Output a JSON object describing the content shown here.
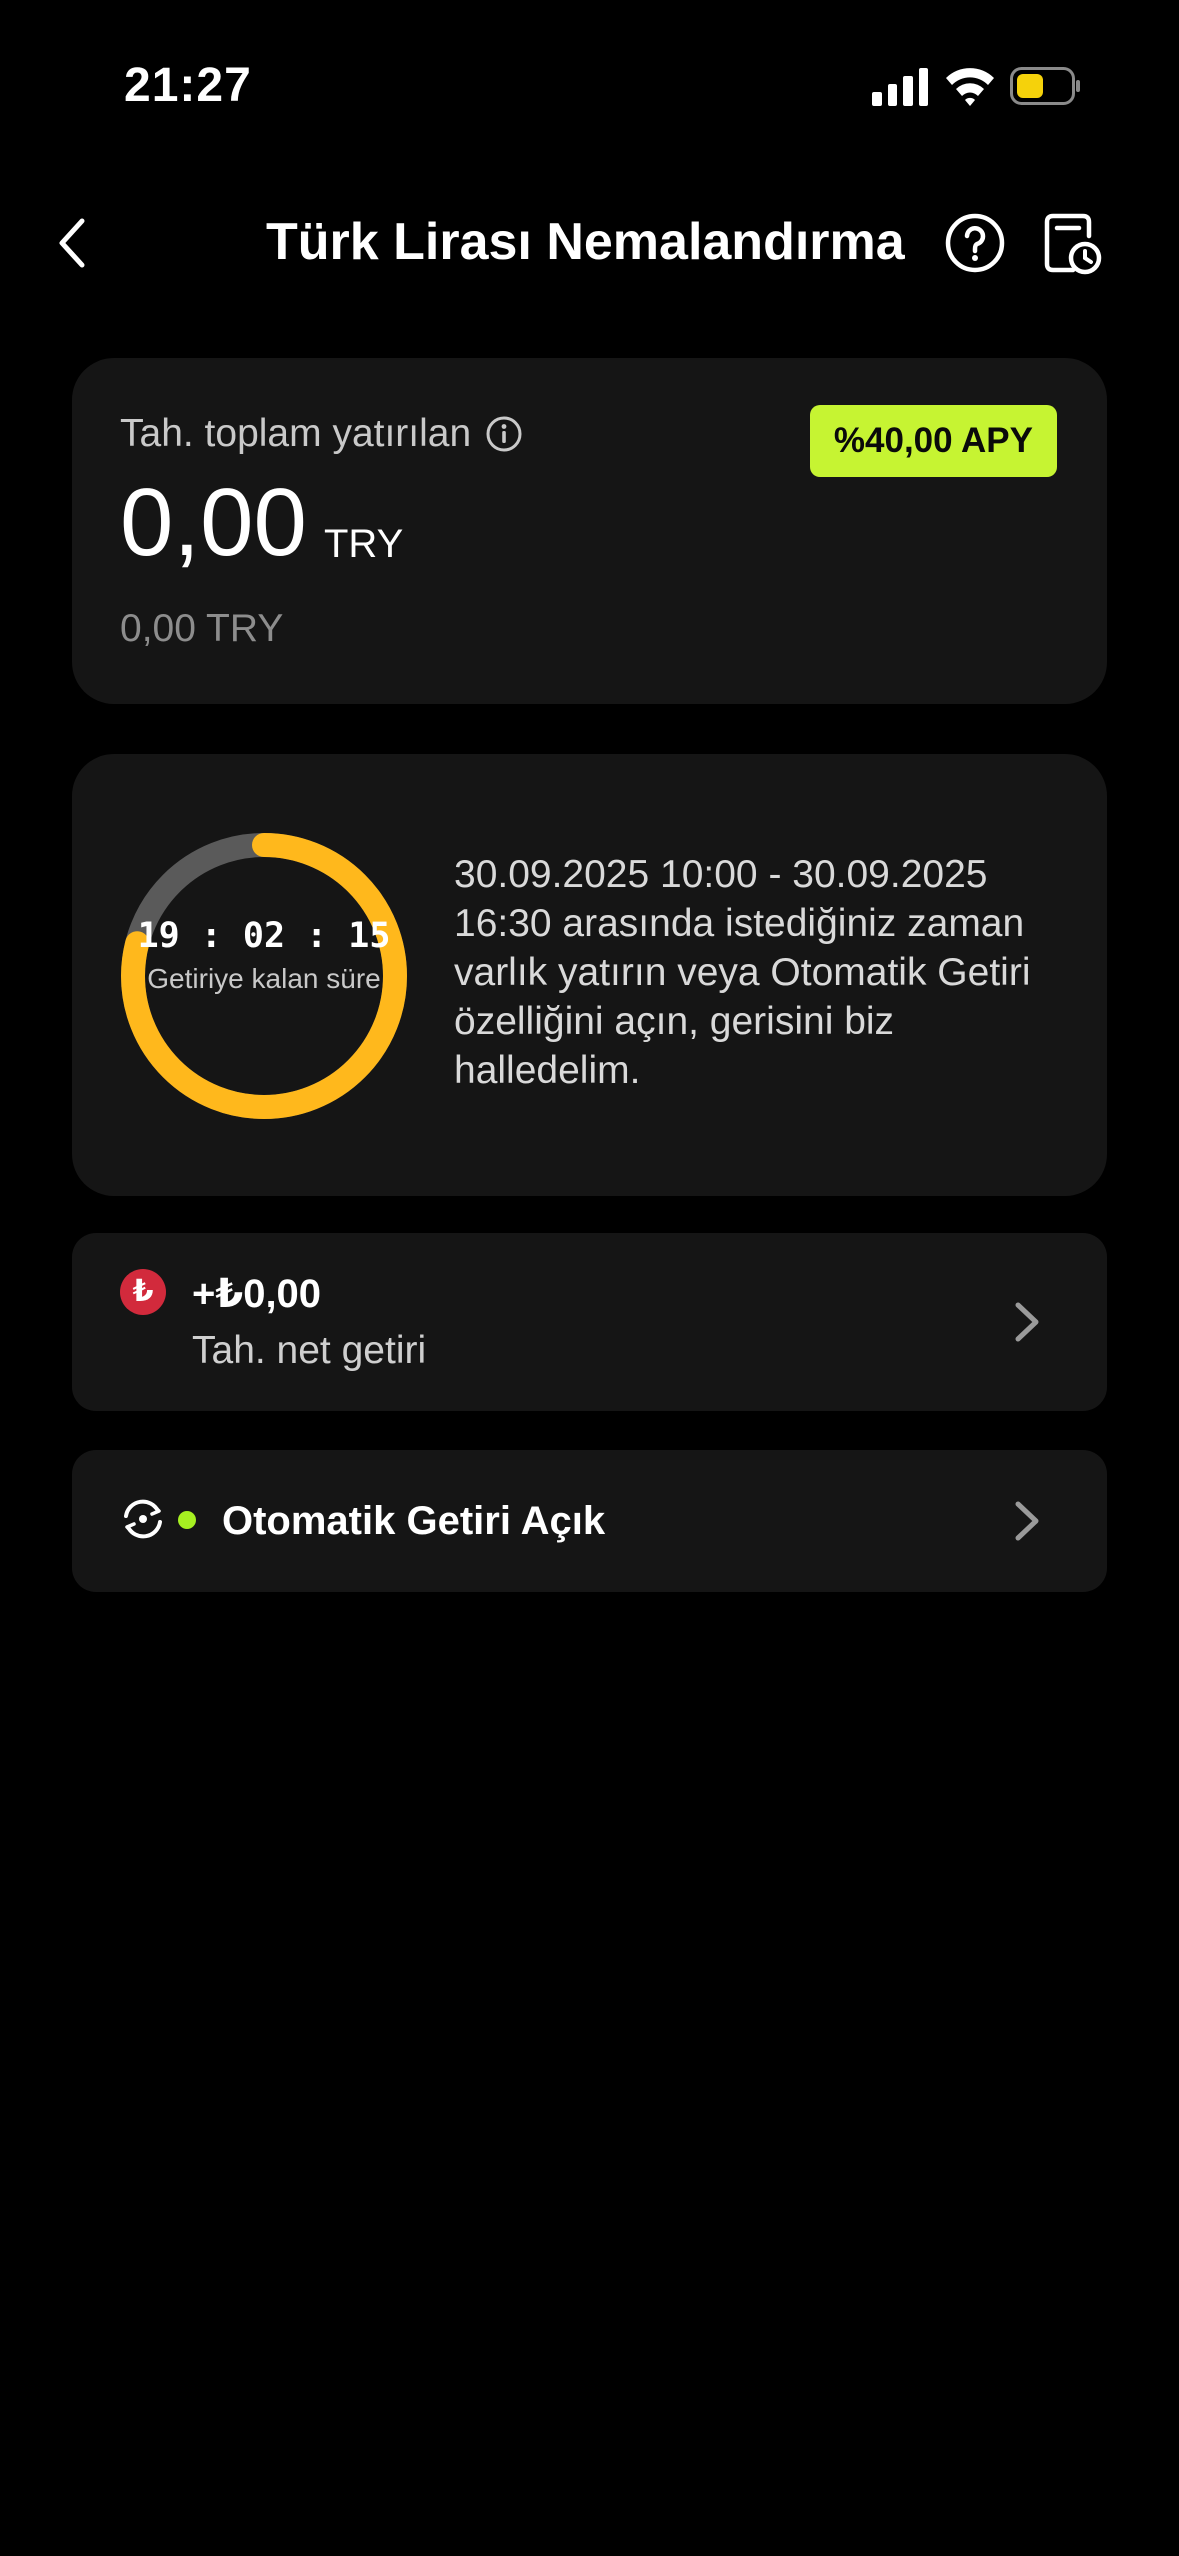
{
  "status_bar": {
    "time": "21:27",
    "battery_color": "#f5d20b",
    "icons": [
      "signal-icon",
      "wifi-icon",
      "battery-icon"
    ]
  },
  "header": {
    "title": "Türk Lirası Nemalandırma",
    "icons": [
      "back-icon",
      "help-icon",
      "history-icon"
    ]
  },
  "summary": {
    "label": "Tah. toplam yatırılan",
    "apy_badge": "%40,00 APY",
    "amount": "0,00",
    "currency": "TRY",
    "secondary_amount": "0,00 TRY",
    "accent_color": "#c6f432"
  },
  "countdown": {
    "time": "19 : 02 : 15",
    "label": "Getiriye kalan süre",
    "progress": 0.79,
    "ring_color": "#ffb81c",
    "description": "30.09.2025 10:00 - 30.09.2025 16:30 arasında istediğiniz zaman varlık yatırın veya Otomatik Getiri özelliğini açın, gerisini biz halledelim."
  },
  "net_return": {
    "badge_symbol": "₺",
    "value": "+₺0,00",
    "label": "Tah. net getiri"
  },
  "auto_return": {
    "label": "Otomatik Getiri Açık",
    "status_color": "#a6f021"
  }
}
